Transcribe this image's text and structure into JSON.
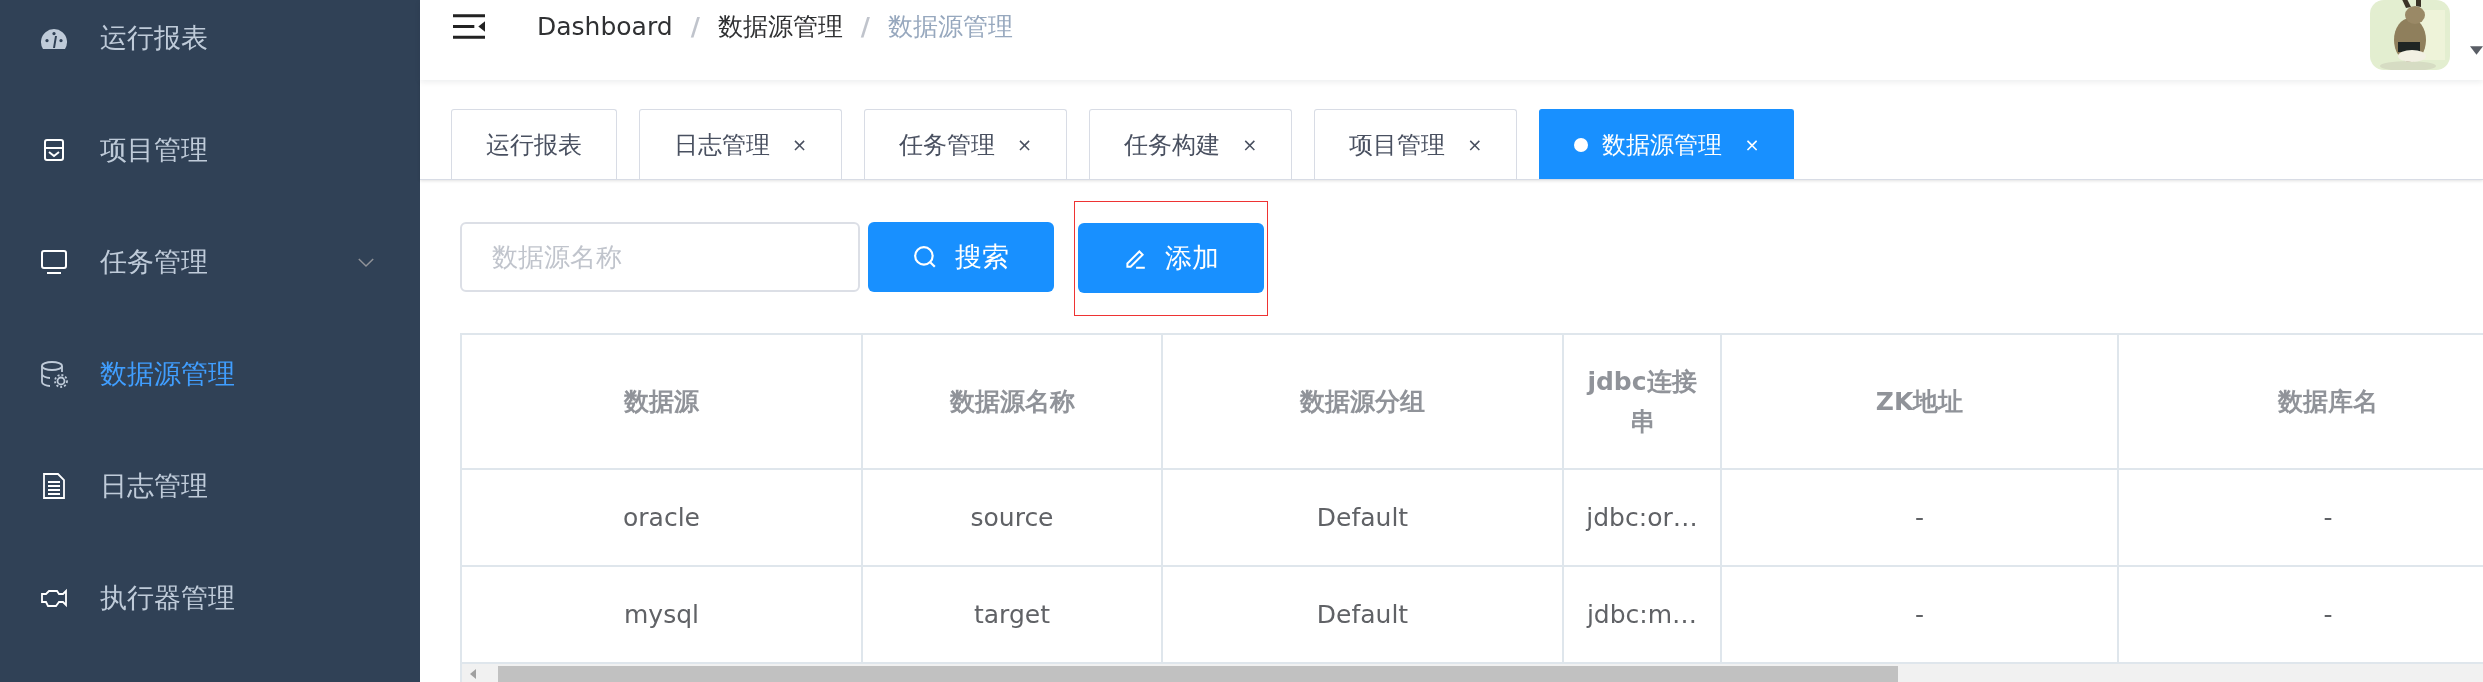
{
  "sidebar": {
    "items": [
      {
        "label": "运行报表",
        "selected": false,
        "kind": "item"
      },
      {
        "label": "项目管理",
        "selected": false,
        "kind": "item"
      },
      {
        "label": "任务管理",
        "selected": false,
        "kind": "submenu"
      },
      {
        "label": "数据源管理",
        "selected": true,
        "kind": "item"
      },
      {
        "label": "日志管理",
        "selected": false,
        "kind": "item"
      },
      {
        "label": "执行器管理",
        "selected": false,
        "kind": "item"
      }
    ]
  },
  "breadcrumb": [
    {
      "label": "Dashboard",
      "kind": "link"
    },
    {
      "label": "/",
      "kind": "separator"
    },
    {
      "label": "数据源管理",
      "kind": "link"
    },
    {
      "label": "/",
      "kind": "separator"
    },
    {
      "label": "数据源管理",
      "kind": "current"
    }
  ],
  "tabs": [
    {
      "label": "运行报表",
      "selected": false
    },
    {
      "label": "日志管理",
      "selected": false,
      "close": "×"
    },
    {
      "label": "任务管理",
      "selected": false,
      "close": "×"
    },
    {
      "label": "任务构建",
      "selected": false,
      "close": "×"
    },
    {
      "label": "项目管理",
      "selected": false,
      "close": "×"
    },
    {
      "label": "数据源管理",
      "selected": true,
      "close": "×"
    }
  ],
  "search": {
    "placeholder": "数据源名称"
  },
  "buttons": [
    {
      "label": "搜索",
      "kind": "search"
    },
    {
      "label": "添加",
      "kind": "add",
      "highlighted": true
    }
  ],
  "table": {
    "columns": [
      "数据源",
      "数据源名称",
      "数据源分组",
      "jdbc连接串",
      "ZK地址",
      "数据库名"
    ],
    "rows": [
      [
        "oracle",
        "source",
        "Default",
        "jdbc:or…",
        "-",
        "-"
      ],
      [
        "mysql",
        "target",
        "Default",
        "jdbc:m…",
        "-",
        "-"
      ]
    ]
  }
}
